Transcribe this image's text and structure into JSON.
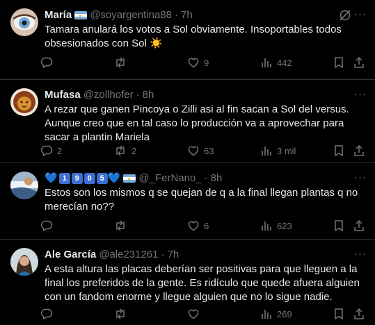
{
  "tweets": [
    {
      "display_name": "María",
      "handle": "@soyargentina88",
      "time": "7h",
      "text": "Tamara anulará los votos a Sol obviamente. Insoportables todos obsesionados con Sol ☀️",
      "replies": "",
      "retweets": "",
      "likes": "9",
      "views": "442"
    },
    {
      "display_name": "Mufasa",
      "handle": "@zollhofer",
      "time": "8h",
      "text": "A rezar que ganen Pincoya o Zilli asi al fin sacan a Sol del versus. Aunque creo que en tal caso lo producción va a aprovechar para sacar a plantin Mariela",
      "replies": "2",
      "retweets": "2",
      "likes": "63",
      "views": "3 mil"
    },
    {
      "display_name_digits": [
        "1",
        "9",
        "0",
        "5"
      ],
      "handle": "@_FerNano_",
      "time": "8h",
      "text": "Estos son los mismos q se quejan de q a la final llegan plantas q no merecían no??",
      "replies": "",
      "retweets": "",
      "likes": "6",
      "views": "623"
    },
    {
      "display_name": "Ale García",
      "handle": "@ale231261",
      "time": "7h",
      "text": "A esta altura las placas deberían ser positivas para que lleguen a la final los preferidos de la gente. Es ridículo que quede afuera alguien con un fandom enorme y llegue alguien que no lo sigue nadie.",
      "replies": "",
      "retweets": "",
      "likes": "",
      "views": "269"
    }
  ],
  "separator_dot": "·",
  "heart_glyph": "💙",
  "more_glyph": "···",
  "accent_color": "#1d9bf0",
  "muted_color": "#71767b",
  "icons": [
    "reply-icon",
    "retweet-icon",
    "like-icon",
    "views-icon",
    "bookmark-icon",
    "share-icon",
    "grok-icon",
    "more-icon"
  ]
}
